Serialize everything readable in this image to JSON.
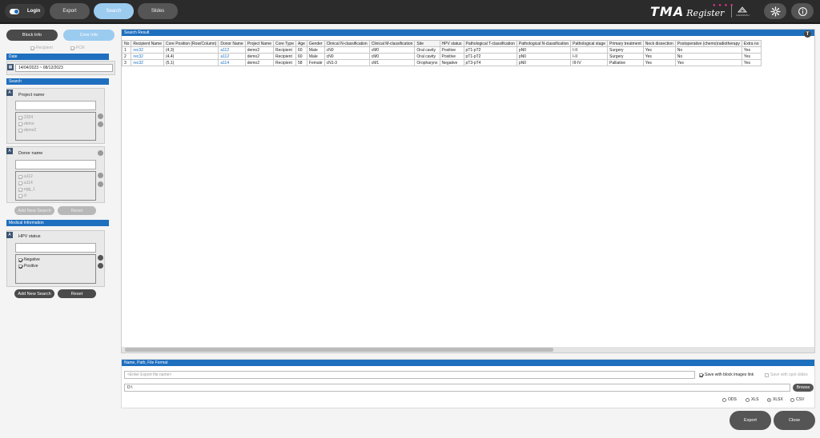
{
  "topbar": {
    "login_label": "Login",
    "tabs": [
      {
        "label": "Export"
      },
      {
        "label": "Search",
        "active": true
      },
      {
        "label": "Slides"
      }
    ],
    "brand_name": "TMA",
    "brand_sub": "Register",
    "brand_dots": "● ● ● ●",
    "brand_logo_text": "NANOPATH"
  },
  "sidebar": {
    "block_info_label": "Block Info",
    "core_info_label": "Core Info",
    "recipient_label": "Recipient",
    "pcr_label": "PCR",
    "date_header": "Date",
    "date_range": "14/04/2023  ~  08/12/2023",
    "search_header": "Search",
    "project_group": {
      "title": "Project name",
      "options": [
        "2324",
        "demo",
        "demo2"
      ]
    },
    "donor_group": {
      "title": "Donor name",
      "options": [
        "a112",
        "a114",
        "egg_1",
        "d"
      ]
    },
    "add_new_search_label": "Add New Search",
    "reset_label": "Reset",
    "medical_header": "Medical Information",
    "hpv_group": {
      "title": "HPV status",
      "options": [
        {
          "label": "Negative",
          "checked": true
        },
        {
          "label": "Positive",
          "checked": true
        }
      ]
    }
  },
  "main": {
    "header": "Search Result",
    "columns": [
      "No",
      "Recipient Name",
      "Core Position (Row/Column)",
      "Donor Name",
      "Project Name",
      "Core Type",
      "Age",
      "Gender",
      "Clinical N-classification",
      "Clinical M-classification",
      "Site",
      "HPV status",
      "Pathological T-classification",
      "Pathological N-classification",
      "Pathological stage",
      "Primary treatment",
      "Neck dissection",
      "Postoperative (chemo)radiotherapy",
      "Extra no"
    ],
    "rows": [
      [
        "1",
        "rec32",
        "(4,3)",
        "a112",
        "demo2",
        "Recipient",
        "60",
        "Male",
        "cN0",
        "cM0",
        "Oral cavity",
        "Positive",
        "pT1-pT2",
        "pN0",
        "I-II",
        "Surgery",
        "Yes",
        "No",
        "Yes"
      ],
      [
        "2",
        "rec32",
        "(4,4)",
        "a112",
        "demo2",
        "Recipient",
        "60",
        "Male",
        "cN0",
        "cM0",
        "Oral cavity",
        "Positive",
        "pT1-pT2",
        "pN0",
        "I-II",
        "Surgery",
        "Yes",
        "No",
        "Yes"
      ],
      [
        "3",
        "rec32",
        "(5,1)",
        "a114",
        "demo2",
        "Recipient",
        "58",
        "Female",
        "cN1-3",
        "cM1",
        "Oropharynx",
        "Negative",
        "pT3-pT4",
        "pN0",
        "III-IV",
        "Palliative",
        "Yes",
        "Yes",
        "Yes"
      ]
    ]
  },
  "export": {
    "header": "Name, Path, File Format",
    "filename_placeholder": "<Enter Export file name>",
    "save_block_link_label": "Save with block images link",
    "save_spot_slides_label": "Save with spot slides",
    "path_value": "D:\\",
    "browse_label": "Browse",
    "formats": [
      {
        "label": "ODS",
        "selected": false
      },
      {
        "label": "XLS",
        "selected": false
      },
      {
        "label": "XLSX",
        "selected": true
      },
      {
        "label": "CSV",
        "selected": false
      }
    ],
    "export_label": "Export",
    "close_label": "Close"
  }
}
